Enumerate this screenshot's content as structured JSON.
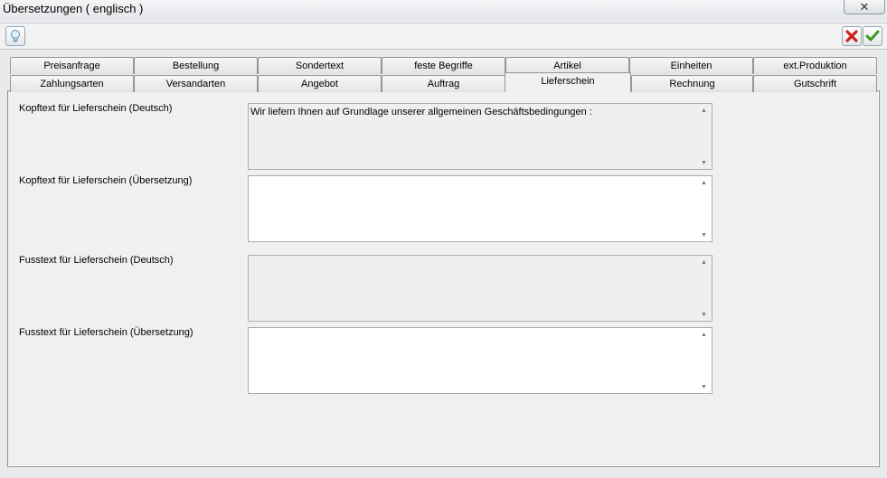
{
  "window": {
    "title": "Übersetzungen ( englisch )",
    "close_label": "✕"
  },
  "toolbar": {
    "hint_icon": "lightbulb-icon",
    "cancel_icon": "red-x-icon",
    "confirm_icon": "green-check-icon"
  },
  "tabs_row1": [
    "Preisanfrage",
    "Bestellung",
    "Sondertext",
    "feste Begriffe",
    "Artikel",
    "Einheiten",
    "ext.Produktion"
  ],
  "tabs_row2": [
    "Zahlungsarten",
    "Versandarten",
    "Angebot",
    "Auftrag",
    "Lieferschein",
    "Rechnung",
    "Gutschrift"
  ],
  "active_tab": "Lieferschein",
  "fields": [
    {
      "label": "Kopftext für Lieferschein (Deutsch)",
      "value": "Wir liefern Ihnen auf Grundlage unserer  allgemeinen Geschäftsbedingungen :",
      "readonly": true
    },
    {
      "label": "Kopftext für Lieferschein (Übersetzung)",
      "value": "",
      "readonly": false
    },
    {
      "label": "Fusstext für Lieferschein (Deutsch)",
      "value": "",
      "readonly": true
    },
    {
      "label": "Fusstext für Lieferschein (Übersetzung)",
      "value": "",
      "readonly": false
    }
  ],
  "scroll_up_glyph": "▲",
  "scroll_down_glyph": "▼"
}
